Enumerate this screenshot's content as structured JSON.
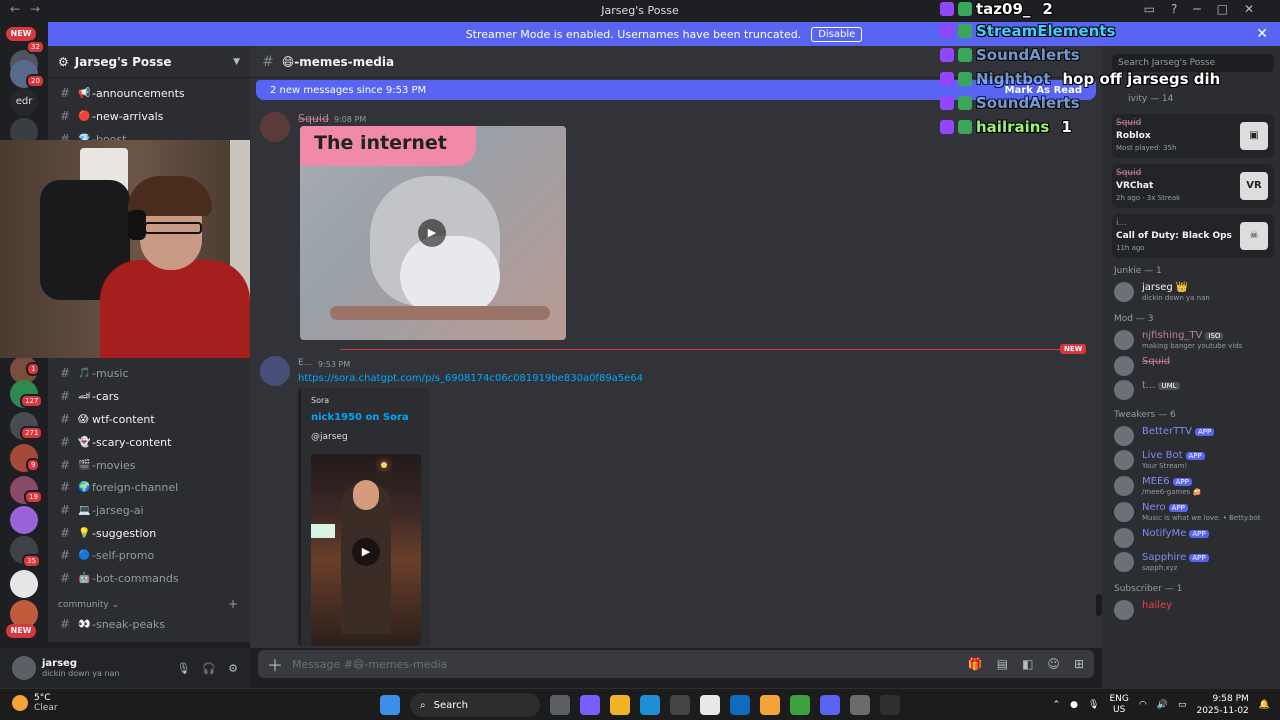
{
  "window": {
    "title": "Jarseg's Posse"
  },
  "banner": {
    "text": "Streamer Mode is enabled. Usernames have been truncated.",
    "disable_label": "Disable"
  },
  "rail": {
    "new_top": "NEW",
    "new_bottom": "NEW",
    "badges": [
      "32",
      "20",
      "1",
      "127",
      "271",
      "9",
      "19",
      "35"
    ],
    "edr_label": "edr"
  },
  "guild": {
    "name": "Jarseg's Posse"
  },
  "channels": [
    {
      "emoji": "📢",
      "name": "-announcements",
      "unread": true
    },
    {
      "emoji": "🔴",
      "name": "-new-arrivals",
      "unread": true
    },
    {
      "emoji": "💎",
      "name": "-boost",
      "unread": false
    },
    {
      "emoji": "🎵",
      "name": "-music",
      "unread": false
    },
    {
      "emoji": "🏎",
      "name": "-cars",
      "unread": true
    },
    {
      "emoji": "😱",
      "name": "wtf-content",
      "unread": true
    },
    {
      "emoji": "👻",
      "name": "-scary-content",
      "unread": true
    },
    {
      "emoji": "🎬",
      "name": "-movies",
      "unread": false
    },
    {
      "emoji": "🌍",
      "name": "foreign-channel",
      "unread": false
    },
    {
      "emoji": "💻",
      "name": "-jarseg-ai",
      "unread": false
    },
    {
      "emoji": "💡",
      "name": "-suggestion",
      "unread": true
    },
    {
      "emoji": "🔵",
      "name": "-self-promo",
      "unread": false
    },
    {
      "emoji": "🤖",
      "name": "-bot-commands",
      "unread": false
    }
  ],
  "category": {
    "name": "community",
    "first": {
      "emoji": "👀",
      "name": "-sneak-peaks"
    }
  },
  "chat": {
    "channel": "😄-memes-media",
    "new_messages_bar": "2 new messages since 9:53 PM",
    "mark_as_read": "Mark As Read",
    "msg1": {
      "author": "S̶q̶u̶i̶d̶",
      "time": "9:08 PM",
      "gif_caption": "The internet"
    },
    "new_divider": "NEW",
    "msg2": {
      "author": "E...",
      "time": "9:53 PM",
      "link": "https://sora.chatgpt.com/p/s_6908174c06c081919be830a0f89a5e64",
      "embed": {
        "provider": "Sora",
        "title": "nick1950 on Sora",
        "description": "@jarseg"
      }
    },
    "composer_placeholder": "Message #😄-memes-media"
  },
  "user": {
    "name": "jarseg",
    "status": "dickin down ya nan"
  },
  "members": {
    "search_placeholder": "Search Jarseg's Posse",
    "activity_header": "ivity — 14",
    "activities": [
      {
        "user": "S̶q̶u̶i̶d̶",
        "game": "Roblox",
        "sub": "Most played: 35h",
        "icon": "roblox-icon"
      },
      {
        "user": "S̶q̶u̶i̶d̶",
        "game": "VRChat",
        "sub": "2h ago · 3x Streak",
        "icon": "vr-icon"
      },
      {
        "user": "i...",
        "game": "Call of Duty: Black Ops",
        "sub": "11h ago",
        "icon": "cod-icon"
      }
    ],
    "sections": [
      {
        "title": "Junkie — 1",
        "items": [
          {
            "name": "jarseg 👑",
            "status": "dickin down ya nan",
            "app": false
          }
        ]
      },
      {
        "title": "Mod — 3",
        "items": [
          {
            "name": "njfishing_TV",
            "status": "making banger youtube vids",
            "app": false,
            "tag": "ISO"
          },
          {
            "name": "S̶q̶u̶i̶d̶",
            "status": "",
            "app": false
          },
          {
            "name": "t...",
            "status": "",
            "app": false,
            "tag": "UML"
          }
        ]
      },
      {
        "title": "Tweakers — 6",
        "items": [
          {
            "name": "BetterTTV",
            "status": "",
            "app": true
          },
          {
            "name": "Live Bot",
            "status": "Your Stream!",
            "app": true
          },
          {
            "name": "MEE6",
            "status": "/mee6-games 🍰",
            "app": true
          },
          {
            "name": "Nero",
            "status": "Music is what we love. • Betty.bot",
            "app": true
          },
          {
            "name": "NotifyMe",
            "status": "",
            "app": true
          },
          {
            "name": "Sapphire",
            "status": "sapph.xyz",
            "app": true
          }
        ]
      },
      {
        "title": "Subscriber — 1",
        "items": [
          {
            "name": "hailey",
            "status": "",
            "app": false
          }
        ]
      }
    ],
    "app_label": "APP"
  },
  "overlay": {
    "rows": [
      {
        "name": "taz09_",
        "count": "2"
      },
      {
        "name": "StreamElements",
        "count": ""
      },
      {
        "name": "SoundAlerts",
        "count": ""
      },
      {
        "name": "Nightbot",
        "count": "hop off jarsegs dih"
      },
      {
        "name": "SoundAlerts",
        "count": ""
      },
      {
        "name": "hailrains",
        "count": "1"
      }
    ]
  },
  "taskbar": {
    "temp": "5°C",
    "weather": "Clear",
    "search": "Search",
    "lang1": "ENG",
    "lang2": "US",
    "time": "9:58 PM",
    "date": "2025-11-02"
  }
}
